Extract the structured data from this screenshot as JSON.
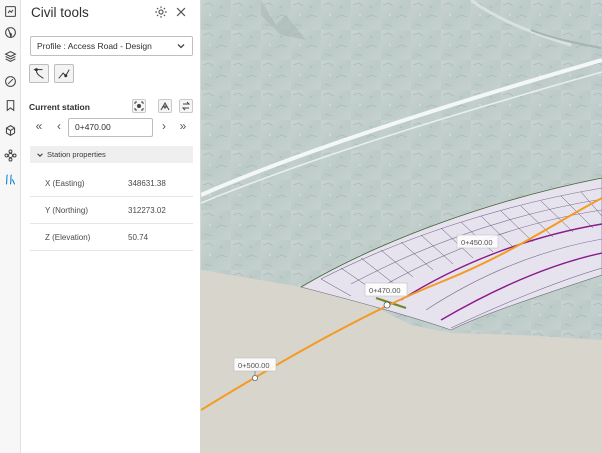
{
  "rail": {
    "icons": [
      "documents-icon",
      "globe-icon",
      "layers-icon",
      "measure-icon",
      "bookmark-icon",
      "model-icon",
      "sun-study-icon",
      "civil-tools-icon"
    ]
  },
  "panel": {
    "title": "Civil tools",
    "profile_select": "Profile : Access Road - Design",
    "current_station_label": "Current station",
    "station_value": "0+470.00",
    "station_properties_label": "Station properties",
    "properties": [
      {
        "key": "X (Easting)",
        "value": "348631.38"
      },
      {
        "key": "Y (Northing)",
        "value": "312273.02"
      },
      {
        "key": "Z (Elevation)",
        "value": "50.74"
      }
    ]
  },
  "viewport": {
    "station_labels": [
      "0+450.00",
      "0+470.00",
      "0+500.00"
    ],
    "alignment_color": "#f59a23",
    "profile_color": "#8b1a8b"
  }
}
